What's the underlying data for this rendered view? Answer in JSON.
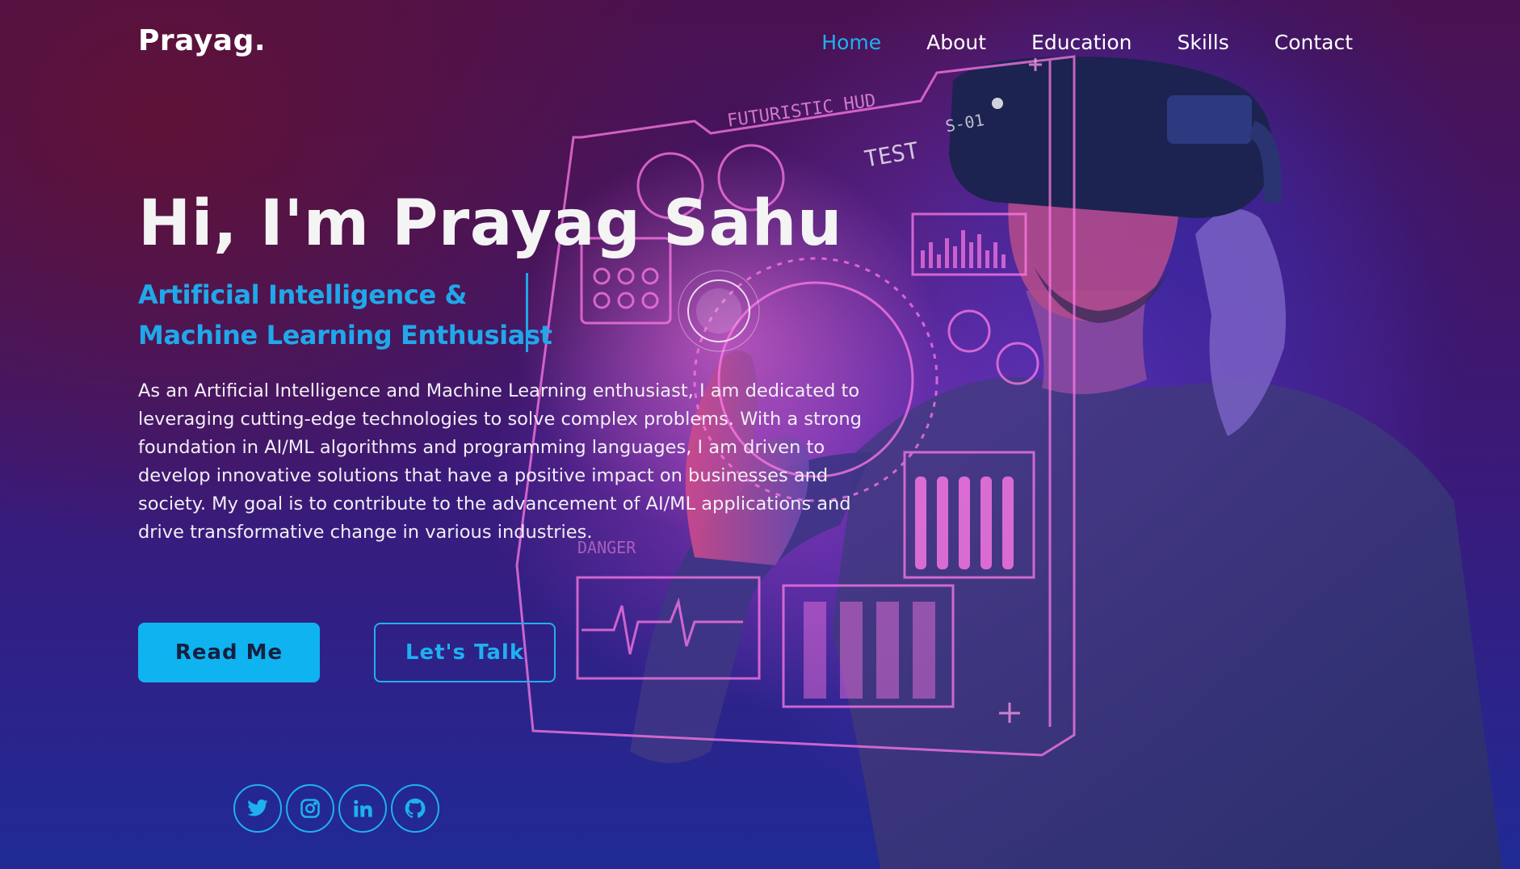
{
  "header": {
    "logo": "Prayag.",
    "nav": [
      {
        "label": "Home",
        "active": true
      },
      {
        "label": "About",
        "active": false
      },
      {
        "label": "Education",
        "active": false
      },
      {
        "label": "Skills",
        "active": false
      },
      {
        "label": "Contact",
        "active": false
      }
    ]
  },
  "hero": {
    "title": "Hi, I'm Prayag Sahu",
    "subtitle_lines": [
      "Artificial Intelligence &",
      "Machine Learning Enthusiast"
    ],
    "intro": "As an Artificial Intelligence and Machine Learning enthusiast, I am dedicated to leveraging cutting-edge technologies to solve complex problems. With a strong foundation in AI/ML algorithms and programming languages, I am driven to develop innovative solutions that have a positive impact on businesses and society. My goal is to contribute to the advancement of AI/ML applications and drive transformative change in various industries.",
    "buttons": {
      "primary": "Read Me",
      "secondary": "Let's Talk"
    }
  },
  "hud": {
    "label_1": "FUTURISTIC HUD",
    "label_2": "TEST",
    "label_3": "S-01",
    "label_4": "DANGER"
  },
  "socials": [
    {
      "icon": "twitter-icon"
    },
    {
      "icon": "instagram-icon"
    },
    {
      "icon": "linkedin-icon"
    },
    {
      "icon": "github-icon"
    }
  ],
  "colors": {
    "accent": "#1fb0f0",
    "button_primary_bg": "#0fb3f0",
    "background_top": "#4a1150",
    "background_bottom": "#202a96",
    "hud_pink": "#ff6ad9"
  }
}
